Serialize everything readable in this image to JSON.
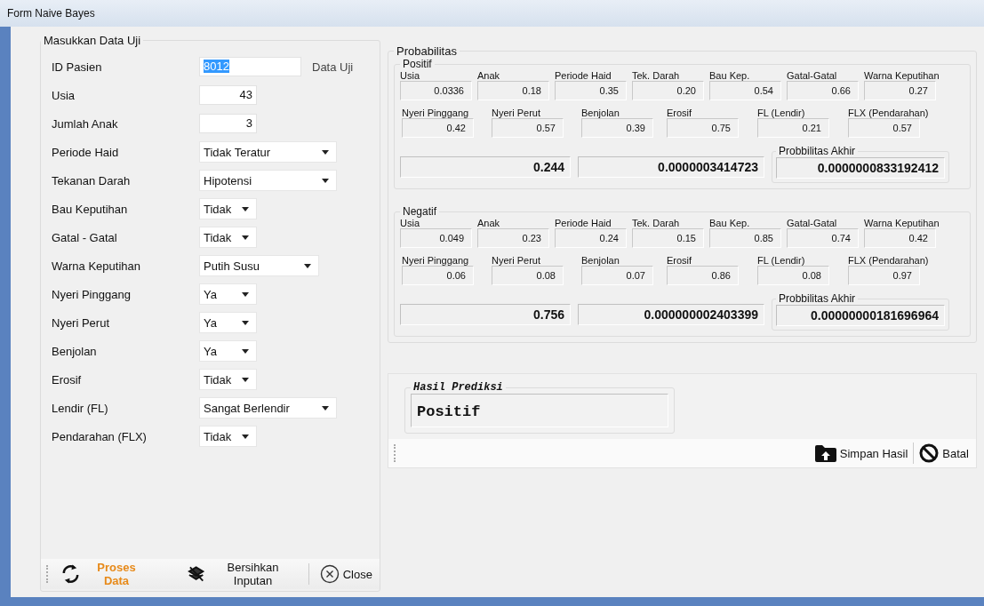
{
  "window": {
    "title": "Form Naive Bayes"
  },
  "input_group": {
    "title": "Masukkan Data Uji",
    "fields": [
      {
        "label": "ID Pasien",
        "kind": "text",
        "value": "8012",
        "highlighted": true,
        "note": "Data Uji"
      },
      {
        "label": "Usia",
        "kind": "number",
        "value": "43"
      },
      {
        "label": "Jumlah Anak",
        "kind": "number",
        "value": "3"
      },
      {
        "label": "Periode Haid",
        "kind": "dropdown",
        "value": "Tidak Teratur"
      },
      {
        "label": "Tekanan Darah",
        "kind": "dropdown",
        "value": "Hipotensi"
      },
      {
        "label": "Bau Keputihan",
        "kind": "dropdown",
        "value": "Tidak"
      },
      {
        "label": "Gatal - Gatal",
        "kind": "dropdown",
        "value": "Tidak"
      },
      {
        "label": "Warna Keputihan",
        "kind": "dropdown",
        "value": "Putih Susu"
      },
      {
        "label": "Nyeri Pinggang",
        "kind": "dropdown",
        "value": "Ya"
      },
      {
        "label": "Nyeri Perut",
        "kind": "dropdown",
        "value": "Ya"
      },
      {
        "label": "Benjolan",
        "kind": "dropdown",
        "value": "Ya"
      },
      {
        "label": "Erosif",
        "kind": "dropdown",
        "value": "Tidak"
      },
      {
        "label": "Lendir (FL)",
        "kind": "dropdown",
        "value": "Sangat Berlendir"
      },
      {
        "label": "Pendarahan (FLX)",
        "kind": "dropdown",
        "value": "Tidak"
      }
    ],
    "toolbar": [
      {
        "kind": "process",
        "label": "Proses Data"
      },
      {
        "kind": "clear",
        "label": "Bersihkan Inputan"
      },
      {
        "kind": "close",
        "label": "Close"
      }
    ]
  },
  "probability_group": {
    "title": "Probabilitas",
    "classes": [
      {
        "title": "Positif",
        "row_1": [
          {
            "label": "Usia",
            "value": "0.0336"
          },
          {
            "label": "Anak",
            "value": "0.18"
          },
          {
            "label": "Periode Haid",
            "value": "0.35"
          },
          {
            "label": "Tek. Darah",
            "value": "0.20"
          },
          {
            "label": "Bau Kep.",
            "value": "0.54"
          },
          {
            "label": "Gatal-Gatal",
            "value": "0.66"
          },
          {
            "label": "Warna Keputihan",
            "value": "0.27"
          }
        ],
        "row_2": [
          {
            "label": "Nyeri Pinggang",
            "value": "0.42"
          },
          {
            "label": "Nyeri Perut",
            "value": "0.57"
          },
          {
            "label": "Benjolan",
            "value": "0.39"
          },
          {
            "label": "Erosif",
            "value": "0.75"
          },
          {
            "label": "FL (Lendir)",
            "value": "0.21"
          },
          {
            "label": "FLX (Pendarahan)",
            "value": "0.57"
          }
        ],
        "prior": "0.244",
        "likelihood": "0.0000003414723",
        "final_label": "Probbilitas Akhir",
        "final": "0.0000000833192412"
      },
      {
        "title": "Negatif",
        "row_1": [
          {
            "label": "Usia",
            "value": "0.049"
          },
          {
            "label": "Anak",
            "value": "0.23"
          },
          {
            "label": "Periode Haid",
            "value": "0.24"
          },
          {
            "label": "Tek. Darah",
            "value": "0.15"
          },
          {
            "label": "Bau Kep.",
            "value": "0.85"
          },
          {
            "label": "Gatal-Gatal",
            "value": "0.74"
          },
          {
            "label": "Warna Keputihan",
            "value": "0.42"
          }
        ],
        "row_2": [
          {
            "label": "Nyeri Pinggang",
            "value": "0.06"
          },
          {
            "label": "Nyeri Perut",
            "value": "0.08"
          },
          {
            "label": "Benjolan",
            "value": "0.07"
          },
          {
            "label": "Erosif",
            "value": "0.86"
          },
          {
            "label": "FL (Lendir)",
            "value": "0.08"
          },
          {
            "label": "FLX (Pendarahan)",
            "value": "0.97"
          }
        ],
        "prior": "0.756",
        "likelihood": "0.000000002403399",
        "final_label": "Probbilitas Akhir",
        "final": "0.00000000181696964"
      }
    ]
  },
  "result": {
    "title": "Hasil Prediksi",
    "value": "Positif",
    "toolbar": [
      {
        "kind": "save",
        "label": "Simpan Hasil"
      },
      {
        "kind": "cancel",
        "label": "Batal"
      }
    ]
  }
}
